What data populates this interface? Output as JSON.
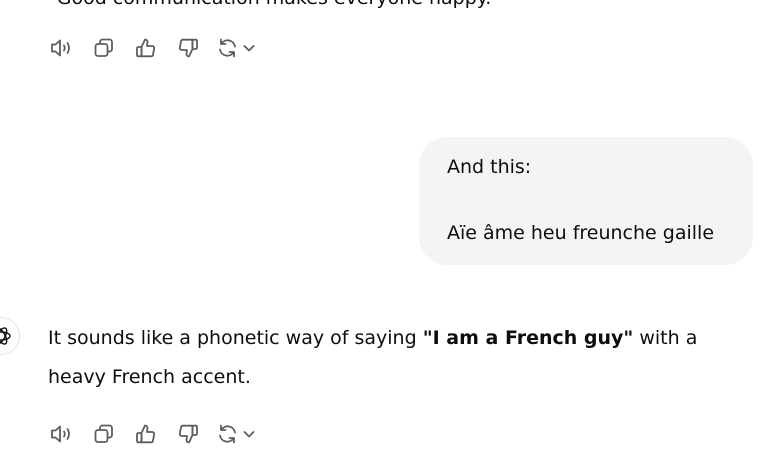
{
  "conversation": {
    "previous_assistant_tail": "\"Good communication makes everyone happy.\"",
    "user_message": {
      "line1": "And this:",
      "line2": "Aïe âme heu freunche gaille"
    },
    "assistant_message": {
      "before": "It sounds like a phonetic way of saying ",
      "bold": "\"I am a French guy\"",
      "after": " with a heavy French accent."
    }
  },
  "icons": {
    "read_aloud": "speaker-icon",
    "copy": "copy-icon",
    "good": "thumbs-up-icon",
    "bad": "thumbs-down-icon",
    "regenerate": "refresh-icon",
    "model_menu": "chevron-down-icon",
    "avatar": "openai-logo-icon"
  },
  "colors": {
    "bubble_bg": "#f4f4f4",
    "icon": "#5d5d5d",
    "text": "#0d0d0d"
  }
}
